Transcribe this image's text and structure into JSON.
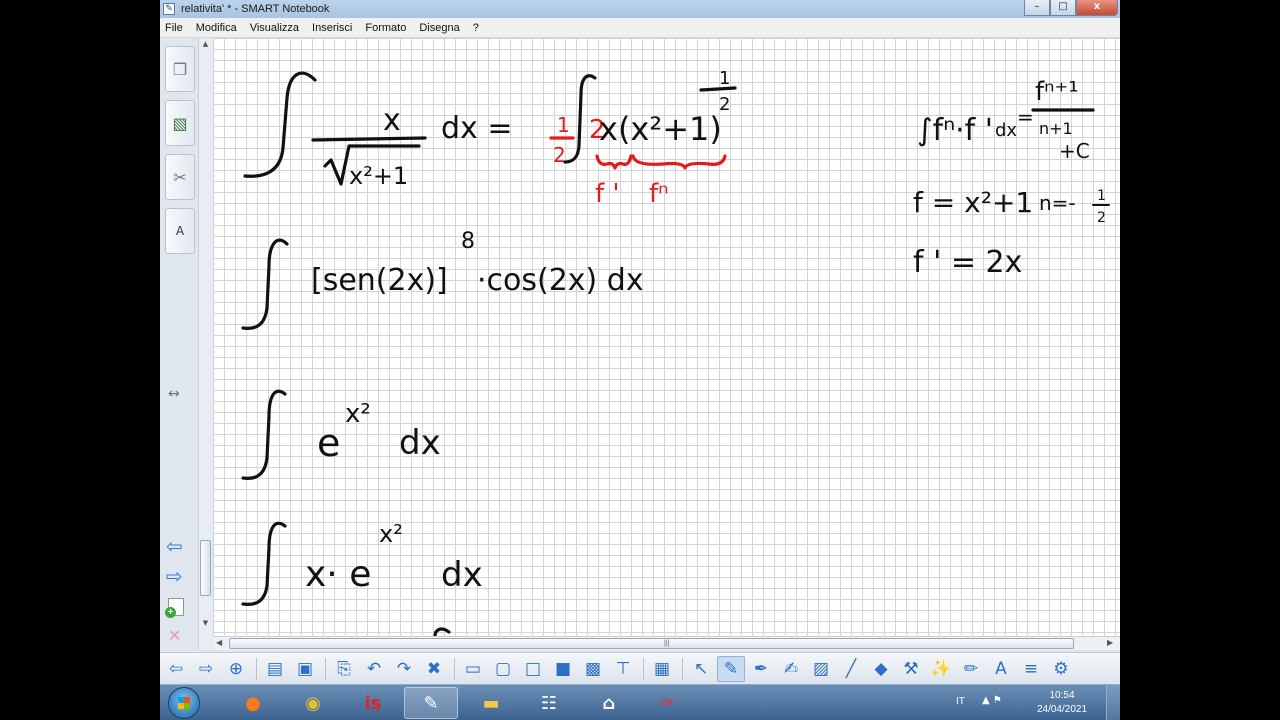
{
  "window": {
    "title": "relativita' * - SMART Notebook",
    "minimize": "–",
    "maximize": "□",
    "close": "x"
  },
  "menu": [
    "File",
    "Modifica",
    "Visualizza",
    "Inserisci",
    "Formato",
    "Disegna",
    "?"
  ],
  "sidebar": {
    "tabs": [
      {
        "name": "page-sorter-icon",
        "glyph": "❐"
      },
      {
        "name": "gallery-icon",
        "glyph": "▧"
      },
      {
        "name": "attachments-icon",
        "glyph": "✂"
      },
      {
        "name": "properties-icon",
        "glyph": "A"
      }
    ]
  },
  "canvas": {
    "lines": {
      "integral_1_num": "x",
      "integral_1_den": "x²+1",
      "integral_1_dx": "dx =",
      "integral_1_rhs": "x(x²+1)",
      "integral_1_exp_num": "1",
      "integral_1_exp_den": "2",
      "integral_1_coef_num": "1",
      "integral_1_coef_den": "2",
      "integral_1_two": "2",
      "label_fprime": "f '",
      "label_fn": "fⁿ",
      "integral_2": "[sen(2x)]",
      "integral_2_exp": "8",
      "integral_2_rest": "·cos(2x)   dx",
      "integral_3_base": "e",
      "integral_3_exp": "x²",
      "integral_3_dx": "dx",
      "integral_4_pre": "x· e",
      "integral_4_exp": "x²",
      "integral_4_dx": "dx",
      "rule_lhs": "∫fⁿ·f '",
      "rule_dx": "dx",
      "rule_eq": "=",
      "rule_num": "fⁿ⁺¹",
      "rule_den": "n+1",
      "rule_c": "+C",
      "def_f": "f = x²+1",
      "def_n": "n=-",
      "def_n_num": "1",
      "def_n_den": "2",
      "def_fprime": "f ' = 2x"
    }
  },
  "toolbar": [
    {
      "name": "previous-page-icon",
      "glyph": "⇦"
    },
    {
      "name": "next-page-icon",
      "glyph": "⇨"
    },
    {
      "name": "add-page-icon",
      "glyph": "⊕"
    },
    {
      "sep": true
    },
    {
      "name": "open-file-icon",
      "glyph": "▤"
    },
    {
      "name": "save-icon",
      "glyph": "▣"
    },
    {
      "sep": true
    },
    {
      "name": "paste-icon",
      "glyph": "⎘"
    },
    {
      "name": "undo-icon",
      "glyph": "↶"
    },
    {
      "name": "redo-icon",
      "glyph": "↷"
    },
    {
      "name": "delete-icon",
      "glyph": "✖"
    },
    {
      "sep": true
    },
    {
      "name": "screen-shade-icon",
      "glyph": "▭"
    },
    {
      "name": "full-screen-icon",
      "glyph": "▢"
    },
    {
      "name": "transparent-background-icon",
      "glyph": "□"
    },
    {
      "name": "display-icon",
      "glyph": "■"
    },
    {
      "name": "screen-capture-icon",
      "glyph": "▩"
    },
    {
      "name": "document-camera-icon",
      "glyph": "⊤"
    },
    {
      "sep": true
    },
    {
      "name": "table-icon",
      "glyph": "▦"
    },
    {
      "sep": true
    },
    {
      "name": "select-icon",
      "glyph": "↖"
    },
    {
      "name": "pen-icon",
      "glyph": "✎",
      "active": true
    },
    {
      "name": "creative-pen-icon",
      "glyph": "✒"
    },
    {
      "name": "highlighter-icon",
      "glyph": "✍"
    },
    {
      "name": "eraser-icon",
      "glyph": "▨"
    },
    {
      "name": "line-icon",
      "glyph": "╱"
    },
    {
      "name": "shapes-icon",
      "glyph": "◆"
    },
    {
      "name": "fill-icon",
      "glyph": "⚒"
    },
    {
      "name": "magic-pen-icon",
      "glyph": "✨"
    },
    {
      "name": "shape-recognition-pen-icon",
      "glyph": "✏"
    },
    {
      "name": "text-icon",
      "glyph": "A"
    },
    {
      "name": "properties-icon",
      "glyph": "≡"
    },
    {
      "name": "more-tools-icon",
      "glyph": "⚙"
    }
  ],
  "taskbar": {
    "apps": [
      {
        "name": "firefox-icon",
        "glyph": "●",
        "color": "#ff7a1a"
      },
      {
        "name": "chrome-icon",
        "glyph": "◉",
        "color": "#e8c22b"
      },
      {
        "name": "iis-icon",
        "glyph": "is",
        "color": "#e02323"
      },
      {
        "name": "smart-notebook-icon",
        "glyph": "✎",
        "color": "#ffffff",
        "active": true
      },
      {
        "name": "file-explorer-icon",
        "glyph": "▬",
        "color": "#f0c84a"
      },
      {
        "name": "network-icon",
        "glyph": "☷",
        "color": "#ffffff"
      },
      {
        "name": "home-icon",
        "glyph": "⌂",
        "color": "#ffffff"
      },
      {
        "name": "pdf-icon",
        "glyph": "✑",
        "color": "#e53030"
      }
    ],
    "lang": "IT",
    "tray": "▲  ⚑",
    "time": "10:54",
    "date": "24/04/2021"
  }
}
